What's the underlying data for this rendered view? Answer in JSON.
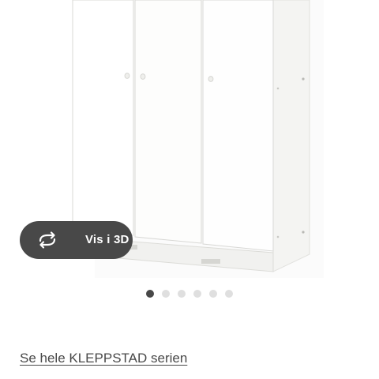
{
  "product_image": {
    "alt_icon": "wardrobe-image"
  },
  "view_3d": {
    "label": "Vis i 3D",
    "icon": "rotate-3d-icon"
  },
  "carousel": {
    "count": 6,
    "active_index": 0
  },
  "series_link": {
    "label": "Se hele KLEPPSTAD serien"
  },
  "colors": {
    "button_bg": "#484848",
    "dot_active": "#484848",
    "dot_inactive": "#dfdfdf",
    "text": "#484848"
  }
}
